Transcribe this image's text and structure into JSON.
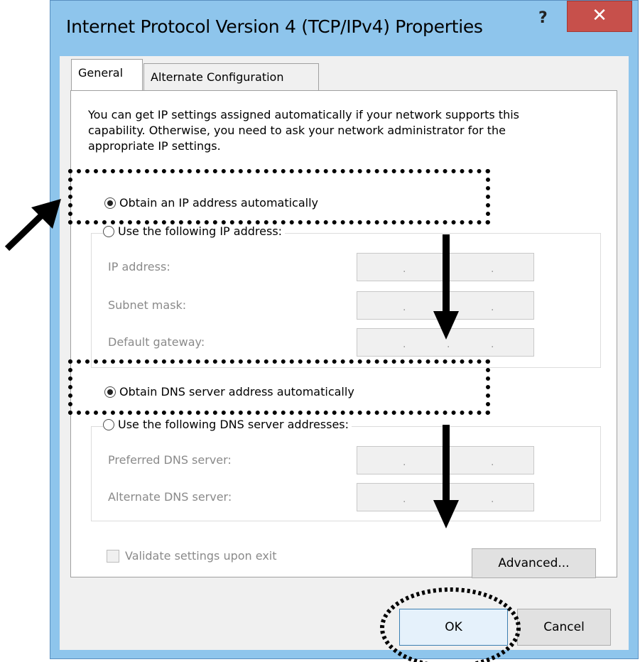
{
  "window": {
    "title": "Internet Protocol Version 4 (TCP/IPv4) Properties",
    "help_glyph": "?",
    "close_glyph": "✕"
  },
  "tabs": [
    {
      "label": "General",
      "selected": true
    },
    {
      "label": "Alternate Configuration",
      "selected": false
    }
  ],
  "intro_text": "You can get IP settings assigned automatically if your network supports this capability. Otherwise, you need to ask your network administrator for the appropriate IP settings.",
  "ip_section": {
    "auto_label": "Obtain an IP address automatically",
    "auto_selected": true,
    "manual_label": "Use the following IP address:",
    "manual_selected": false,
    "fields": [
      {
        "label": "IP address:",
        "separator": "."
      },
      {
        "label": "Subnet mask:",
        "separator": "."
      },
      {
        "label": "Default gateway:",
        "separator": "."
      }
    ]
  },
  "dns_section": {
    "auto_label": "Obtain DNS server address automatically",
    "auto_selected": true,
    "manual_label": "Use the following DNS server addresses:",
    "manual_selected": false,
    "fields": [
      {
        "label": "Preferred DNS server:",
        "separator": "."
      },
      {
        "label": "Alternate DNS server:",
        "separator": "."
      }
    ]
  },
  "validate_label": "Validate settings upon exit",
  "validate_checked": false,
  "buttons": {
    "advanced": "Advanced...",
    "ok": "OK",
    "cancel": "Cancel"
  },
  "colors": {
    "frame": "#8ec5ec",
    "close": "#c7504b",
    "annotation": "#000000"
  }
}
